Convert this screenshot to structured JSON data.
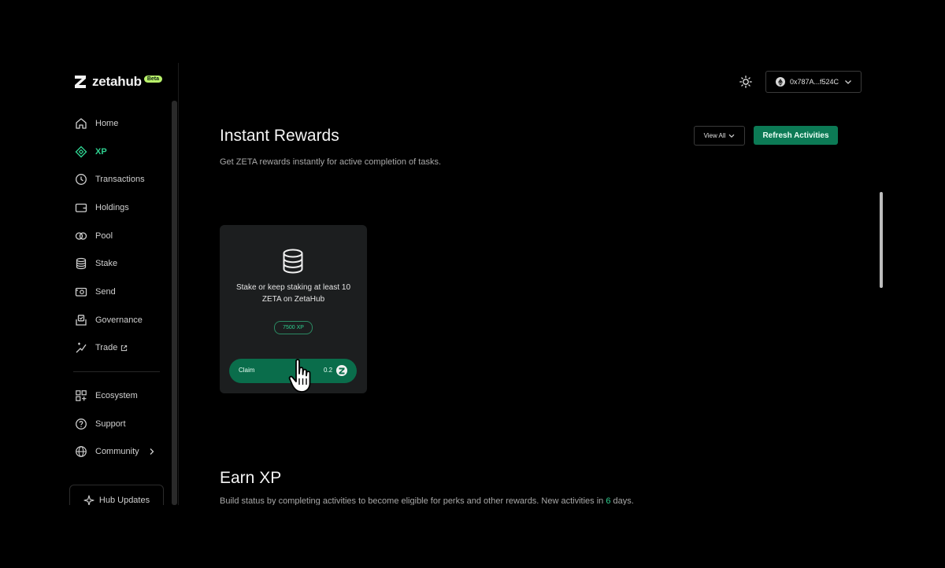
{
  "logo": {
    "text": "zetahub",
    "badge": "Beta"
  },
  "nav": {
    "items": [
      {
        "label": "Home",
        "icon": "home-icon"
      },
      {
        "label": "XP",
        "icon": "diamond-icon",
        "active": true
      },
      {
        "label": "Transactions",
        "icon": "clock-icon"
      },
      {
        "label": "Holdings",
        "icon": "wallet-icon"
      },
      {
        "label": "Pool",
        "icon": "pool-icon"
      },
      {
        "label": "Stake",
        "icon": "database-icon"
      },
      {
        "label": "Send",
        "icon": "send-icon"
      },
      {
        "label": "Governance",
        "icon": "governance-icon"
      },
      {
        "label": "Trade",
        "icon": "trade-icon",
        "external": true
      }
    ],
    "secondary": [
      {
        "label": "Ecosystem",
        "icon": "grid-plus-icon"
      },
      {
        "label": "Support",
        "icon": "help-icon"
      },
      {
        "label": "Community",
        "icon": "globe-icon",
        "chevron": true
      }
    ],
    "hub_updates": "Hub Updates"
  },
  "header": {
    "wallet_address": "0x787A...f524C"
  },
  "instant": {
    "title": "Instant Rewards",
    "subtitle": "Get ZETA rewards instantly for active completion of tasks.",
    "view_all": "View All",
    "refresh": "Refresh Activities",
    "card": {
      "description": "Stake or keep staking at least 10 ZETA on ZetaHub",
      "xp": "7500 XP",
      "claim": "Claim",
      "amount": "0.2"
    }
  },
  "earn": {
    "title": "Earn XP",
    "subtitle_pre": "Build status by completing activities to become eligible for perks and other rewards. New activities in ",
    "days": "6",
    "subtitle_post": " days."
  },
  "colors": {
    "accent": "#2ecf8f",
    "button_green": "#0c7a55",
    "background": "#000000",
    "card": "#1c1e1f"
  }
}
